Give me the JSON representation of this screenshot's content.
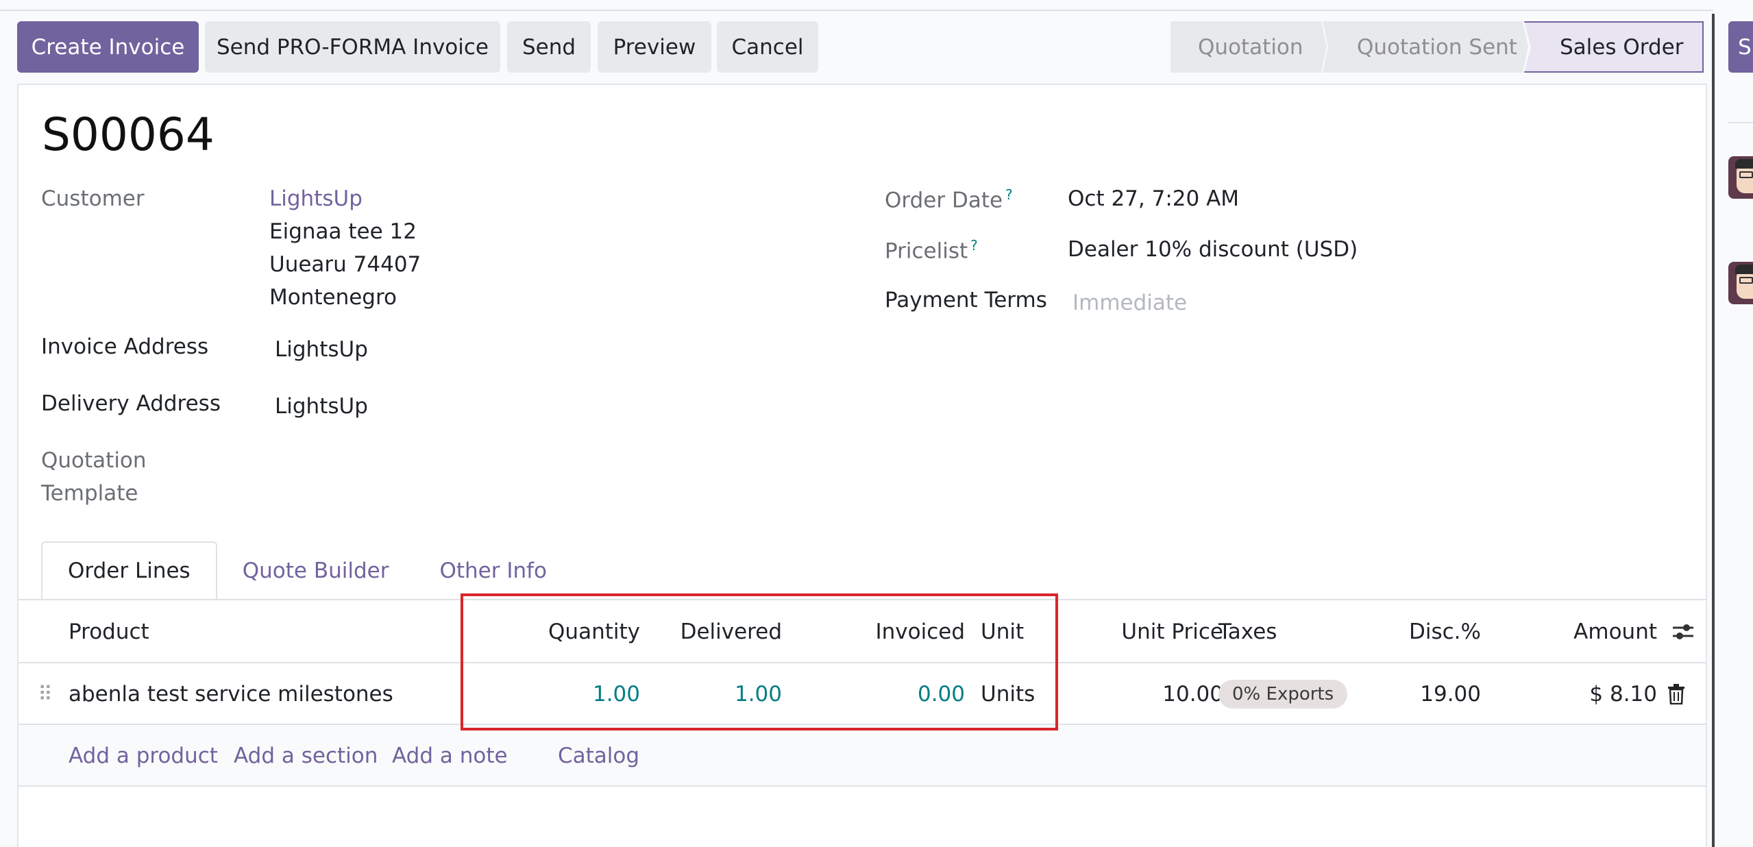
{
  "actions": {
    "create_invoice": "Create Invoice",
    "send_proforma": "Send PRO-FORMA Invoice",
    "send": "Send",
    "preview": "Preview",
    "cancel": "Cancel"
  },
  "status": {
    "stages": [
      "Quotation",
      "Quotation Sent",
      "Sales Order"
    ],
    "current": "Sales Order"
  },
  "edge_button_label": "S",
  "record": {
    "title": "S00064",
    "customer": {
      "label": "Customer",
      "name": "LightsUp",
      "address_line1": "Eignaa tee 12",
      "address_line2": "Uuearu 74407",
      "address_line3": "Montenegro"
    },
    "invoice_address": {
      "label": "Invoice Address",
      "value": "LightsUp"
    },
    "delivery_address": {
      "label": "Delivery Address",
      "value": "LightsUp"
    },
    "quotation_template": {
      "label_line1": "Quotation",
      "label_line2": "Template"
    },
    "order_date": {
      "label": "Order Date",
      "value": "Oct 27, 7:20 AM"
    },
    "pricelist": {
      "label": "Pricelist",
      "value": "Dealer 10% discount (USD)"
    },
    "payment_terms": {
      "label": "Payment Terms",
      "placeholder": "Immediate"
    },
    "help_mark": "?"
  },
  "tabs": [
    "Order Lines",
    "Quote Builder",
    "Other Info"
  ],
  "table": {
    "headers": {
      "product": "Product",
      "quantity": "Quantity",
      "delivered": "Delivered",
      "invoiced": "Invoiced",
      "unit": "Unit",
      "unit_price": "Unit Price",
      "taxes": "Taxes",
      "disc": "Disc.%",
      "amount": "Amount"
    },
    "rows": [
      {
        "product": "abenla test service milestones",
        "quantity": "1.00",
        "delivered": "1.00",
        "invoiced": "0.00",
        "unit": "Units",
        "unit_price": "10.00",
        "taxes": "0% Exports",
        "disc": "19.00",
        "amount": "$ 8.10"
      }
    ],
    "add_links": {
      "product": "Add a product",
      "section": "Add a section",
      "note": "Add a note",
      "catalog": "Catalog"
    }
  },
  "colors": {
    "primary": "#71639e",
    "link_teal": "#017e84",
    "highlight": "#d9262b"
  }
}
